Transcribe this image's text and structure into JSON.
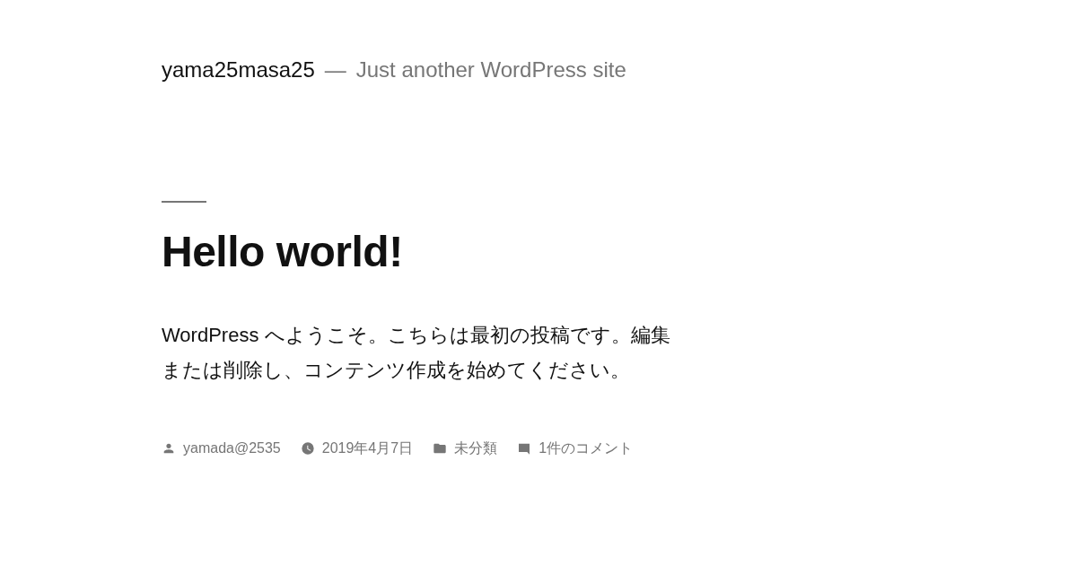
{
  "site": {
    "title": "yama25masa25",
    "separator": "—",
    "tagline": "Just another WordPress site"
  },
  "post": {
    "title": "Hello world!",
    "body": "WordPress へようこそ。こちらは最初の投稿です。編集または削除し、コンテンツ作成を始めてください。",
    "meta": [
      {
        "kind": "author",
        "text": "yamada@2535"
      },
      {
        "kind": "date",
        "text": "2019年4月7日"
      },
      {
        "kind": "category",
        "text": "未分類"
      },
      {
        "kind": "comments",
        "text": "1件のコメント"
      }
    ]
  }
}
